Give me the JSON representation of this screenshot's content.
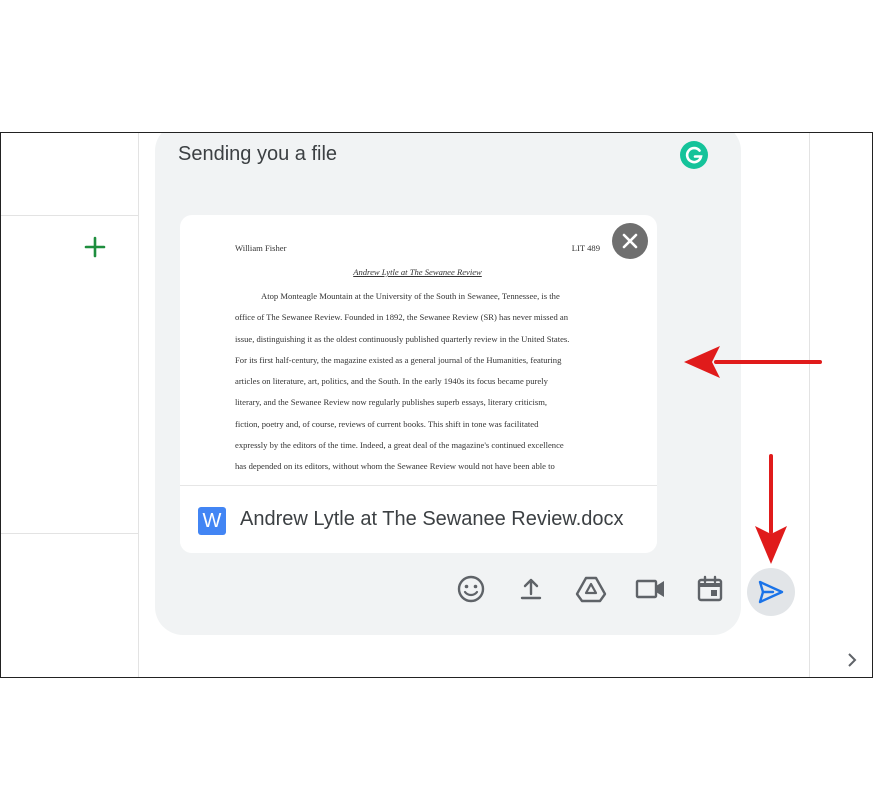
{
  "compose": {
    "message": "Sending you a file",
    "attachment": {
      "file_name": "Andrew Lytle at The Sewanee Review.docx",
      "file_type_letter": "W",
      "preview": {
        "author": "William Fisher",
        "course": "LIT 489",
        "title": "Andrew Lytle at The Sewanee Review",
        "lines": [
          "Atop Monteagle Mountain at the University of the South in Sewanee, Tennessee, is the",
          "office of The Sewanee Review. Founded in 1892, the Sewanee Review (SR) has never missed an",
          "issue, distinguishing it as the oldest continuously published quarterly review in the United States.",
          "For its first half-century, the magazine existed as a general journal of the Humanities, featuring",
          "articles on literature, art, politics, and the South. In the early 1940s its focus became purely",
          "literary, and the Sewanee Review now regularly publishes superb essays, literary criticism,",
          "fiction, poetry and, of course, reviews of current books. This shift in tone was facilitated",
          "expressly by the editors of the time. Indeed, a great deal of the magazine's continued excellence",
          "has depended on its editors, without whom the Sewanee Review would not have been able to"
        ]
      }
    },
    "toolbar": [
      "emoji-icon",
      "upload-icon",
      "google-drive-icon",
      "video-call-icon",
      "calendar-icon",
      "send-icon"
    ]
  },
  "colors": {
    "accent": "#1a73e8",
    "annotation_arrow": "#e01b1b",
    "grammarly": "#15c39a",
    "word_icon": "#4285f4",
    "plus": "#1e8e3e"
  }
}
